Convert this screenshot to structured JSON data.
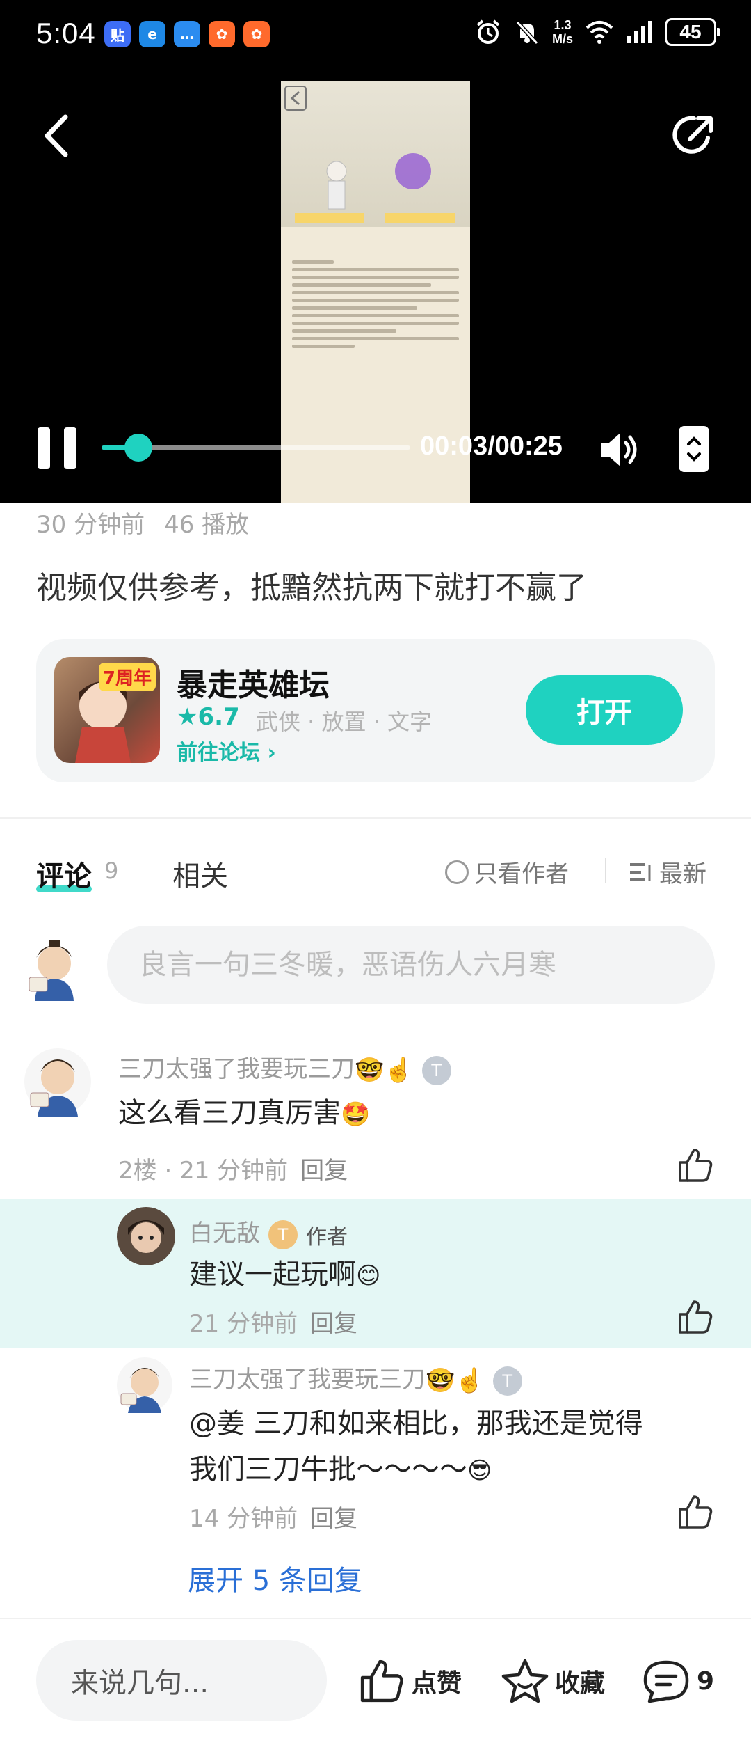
{
  "status_bar": {
    "time": "5:04",
    "apps": [
      "贴",
      "e",
      "…",
      "✿",
      "✿"
    ],
    "speed_value": "1.3",
    "speed_unit": "M/s",
    "battery": "45"
  },
  "video": {
    "current_time": "00:03",
    "duration": "00:25",
    "time_display": "00:03/00:25",
    "progress": 0.12
  },
  "post": {
    "time_ago": "30 分钟前",
    "plays": "46 播放",
    "description": "视频仅供参考，抵黯然抗两下就打不赢了"
  },
  "game_card": {
    "badge": "7周年",
    "name": "暴走英雄坛",
    "rating": "6.7",
    "tags": "武侠 · 放置 · 文字",
    "forum_link": "前往论坛",
    "open_label": "打开"
  },
  "tabs": {
    "comments_label": "评论",
    "comments_count": "9",
    "related_label": "相关",
    "only_author": "只看作者",
    "sort_label": "最新"
  },
  "comment_input": {
    "placeholder": "良言一句三冬暖，恶语伤人六月寒"
  },
  "comments": [
    {
      "username": "三刀太强了我要玩三刀",
      "name_emojis": "🤓☝️",
      "level": "T",
      "text": "这么看三刀真厉害",
      "text_emoji": "🤩",
      "floor": "2楼",
      "time": "21 分钟前",
      "reply_label": "回复"
    }
  ],
  "replies": [
    {
      "username": "白无敌",
      "level": "T",
      "author_tag": "作者",
      "text": "建议一起玩啊",
      "text_emoji": "😊",
      "time": "21 分钟前",
      "reply_label": "回复"
    },
    {
      "username": "三刀太强了我要玩三刀",
      "name_emojis": "🤓☝️",
      "level": "T",
      "text_line1": "@姜  三刀和如来相比，那我还是觉得",
      "text_line2": "我们三刀牛批～～～～",
      "text_emoji": "😎",
      "time": "14 分钟前",
      "reply_label": "回复"
    }
  ],
  "expand_replies": "展开 5 条回复",
  "bottom_bar": {
    "input_placeholder": "来说几句...",
    "like_label": "点赞",
    "collect_label": "收藏",
    "comment_count": "9"
  },
  "colors": {
    "accent": "#1fd2c0",
    "accent_text": "#1ab9a8",
    "link": "#2a6fd6",
    "highlight_bg": "#e4f7f5"
  }
}
